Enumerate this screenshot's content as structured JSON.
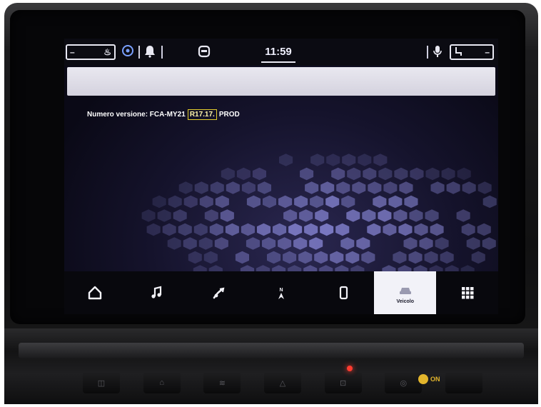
{
  "statusbar": {
    "time": "11:59"
  },
  "version": {
    "label_prefix": "Numero versione: FCA-MY21",
    "highlight": "R17.17.",
    "label_suffix": "PROD"
  },
  "nav": {
    "items": [
      {
        "name": "home",
        "icon": "home-icon",
        "label": ""
      },
      {
        "name": "media",
        "icon": "music-note-icon",
        "label": ""
      },
      {
        "name": "climate",
        "icon": "fan-icon",
        "label": ""
      },
      {
        "name": "navigation",
        "icon": "compass-icon",
        "label": ""
      },
      {
        "name": "phone",
        "icon": "phone-icon",
        "label": ""
      },
      {
        "name": "vehicle",
        "icon": "car-icon",
        "label": "Veicolo"
      },
      {
        "name": "apps",
        "icon": "grid-icon",
        "label": ""
      }
    ],
    "active": "vehicle"
  },
  "console": {
    "on_label": "ON"
  },
  "colors": {
    "highlight_border": "#e3cc2c",
    "screen_bg": "#15132c",
    "hex_tint": "#8f8ee0"
  }
}
